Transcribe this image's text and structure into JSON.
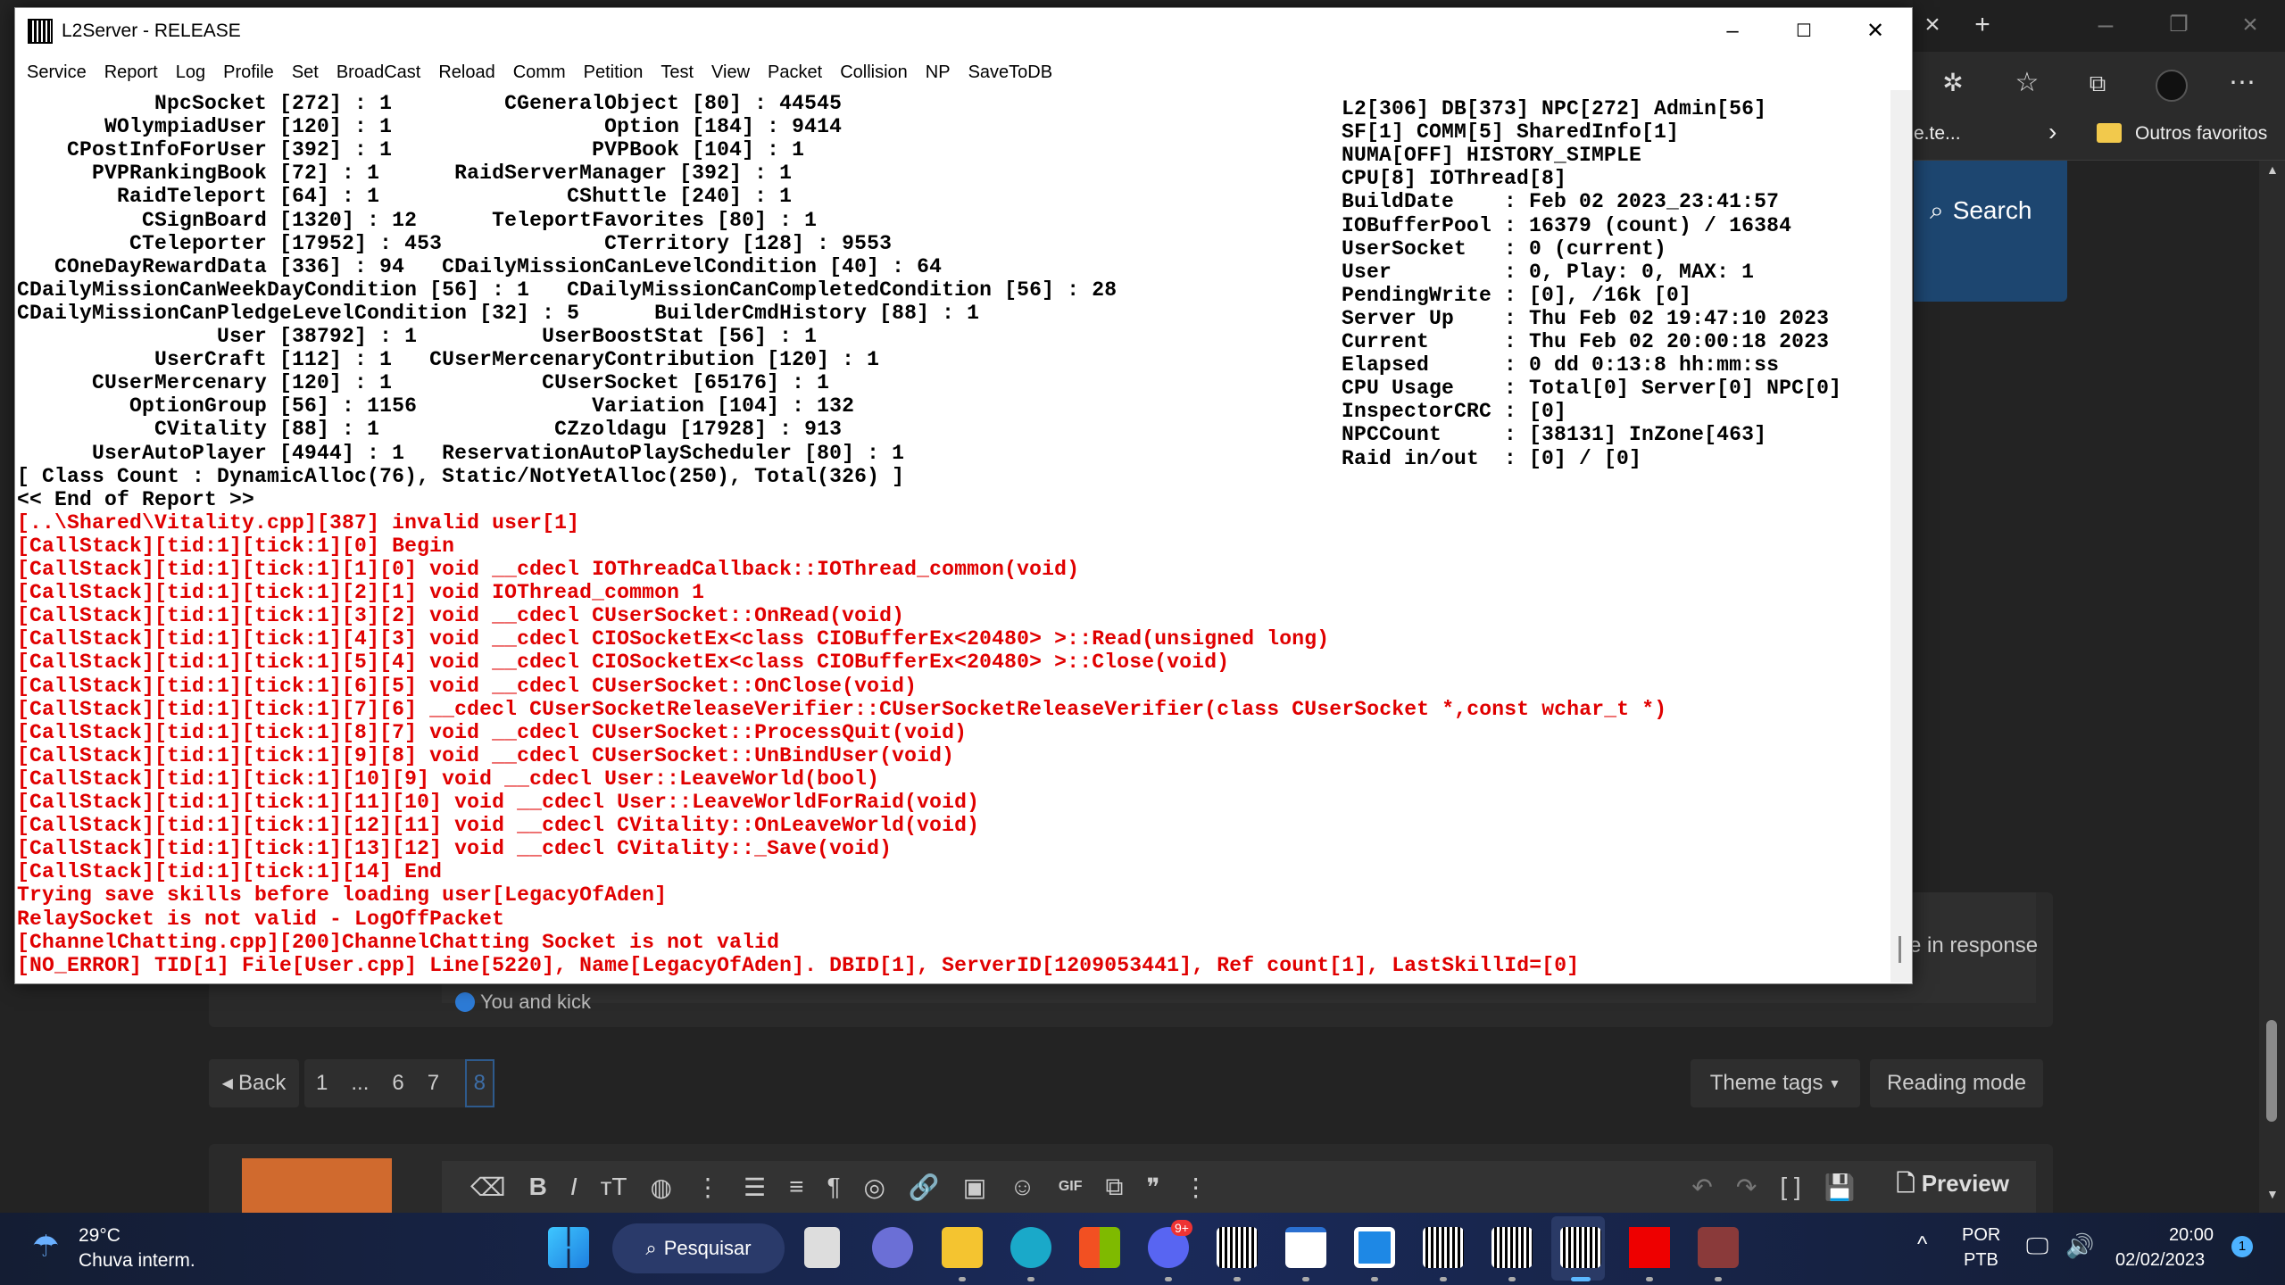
{
  "window": {
    "title": "L2Server - RELEASE"
  },
  "menu": [
    "Service",
    "Report",
    "Log",
    "Profile",
    "Set",
    "BroadCast",
    "Reload",
    "Comm",
    "Petition",
    "Test",
    "View",
    "Packet",
    "Collision",
    "NP",
    "SaveToDB"
  ],
  "report": {
    "rows": [
      [
        [
          "NpcSocket",
          "272",
          "1"
        ],
        [
          "CGeneralObject",
          "80",
          "44545"
        ]
      ],
      [
        [
          "WOlympiadUser",
          "120",
          "1"
        ],
        [
          "Option",
          "184",
          "9414"
        ]
      ],
      [
        [
          "CPostInfoForUser",
          "392",
          "1"
        ],
        [
          "PVPBook",
          "104",
          "1"
        ]
      ],
      [
        [
          "PVPRankingBook",
          "72",
          "1"
        ],
        [
          "RaidServerManager",
          "392",
          "1"
        ]
      ],
      [
        [
          "RaidTeleport",
          "64",
          "1"
        ],
        [
          "CShuttle",
          "240",
          "1"
        ]
      ],
      [
        [
          "CSignBoard",
          "1320",
          "12"
        ],
        [
          "TeleportFavorites",
          "80",
          "1"
        ]
      ],
      [
        [
          "CTeleporter",
          "17952",
          "453"
        ],
        [
          "CTerritory",
          "128",
          "9553"
        ]
      ],
      [
        [
          "COneDayRewardData",
          "336",
          "94"
        ],
        [
          "CDailyMissionCanLevelCondition",
          "40",
          "64"
        ]
      ],
      [
        [
          "CDailyMissionCanWeekDayCondition",
          "56",
          "1"
        ],
        [
          "CDailyMissionCanCompletedCondition",
          "56",
          "28"
        ]
      ],
      [
        [
          "CDailyMissionCanPledgeLevelCondition",
          "32",
          "5"
        ],
        [
          "BuilderCmdHistory",
          "88",
          "1"
        ]
      ],
      [
        [
          "User",
          "38792",
          "1"
        ],
        [
          "UserBoostStat",
          "56",
          "1"
        ]
      ],
      [
        [
          "UserCraft",
          "112",
          "1"
        ],
        [
          "CUserMercenaryContribution",
          "120",
          "1"
        ]
      ],
      [
        [
          "CUserMercenary",
          "120",
          "1"
        ],
        [
          "CUserSocket",
          "65176",
          "1"
        ]
      ],
      [
        [
          "OptionGroup",
          "56",
          "1156"
        ],
        [
          "Variation",
          "104",
          "132"
        ]
      ],
      [
        [
          "CVitality",
          "88",
          "1"
        ],
        [
          "CZzoldagu",
          "17928",
          "913"
        ]
      ],
      [
        [
          "UserAutoPlayer",
          "4944",
          "1"
        ],
        [
          "ReservationAutoPlayScheduler",
          "80",
          "1"
        ]
      ]
    ],
    "class_count": "[ Class Count : DynamicAlloc(76), Static/NotYetAlloc(250), Total(326) ]",
    "end": "<< End of Report >>"
  },
  "errors": [
    "[..\\Shared\\Vitality.cpp][387] invalid user[1]",
    "[CallStack][tid:1][tick:1][0] Begin",
    "[CallStack][tid:1][tick:1][1][0] void __cdecl IOThreadCallback::IOThread_common(void)",
    "[CallStack][tid:1][tick:1][2][1] void IOThread_common 1",
    "[CallStack][tid:1][tick:1][3][2] void __cdecl CUserSocket::OnRead(void)",
    "[CallStack][tid:1][tick:1][4][3] void __cdecl CIOSocketEx<class CIOBufferEx<20480> >::Read(unsigned long)",
    "[CallStack][tid:1][tick:1][5][4] void __cdecl CIOSocketEx<class CIOBufferEx<20480> >::Close(void)",
    "[CallStack][tid:1][tick:1][6][5] void __cdecl CUserSocket::OnClose(void)",
    "[CallStack][tid:1][tick:1][7][6] __cdecl CUserSocketReleaseVerifier::CUserSocketReleaseVerifier(class CUserSocket *,const wchar_t *)",
    "[CallStack][tid:1][tick:1][8][7] void __cdecl CUserSocket::ProcessQuit(void)",
    "[CallStack][tid:1][tick:1][9][8] void __cdecl CUserSocket::UnBindUser(void)",
    "[CallStack][tid:1][tick:1][10][9] void __cdecl User::LeaveWorld(bool)",
    "[CallStack][tid:1][tick:1][11][10] void __cdecl User::LeaveWorldForRaid(void)",
    "[CallStack][tid:1][tick:1][12][11] void __cdecl CVitality::OnLeaveWorld(void)",
    "[CallStack][tid:1][tick:1][13][12] void __cdecl CVitality::_Save(void)",
    "[CallStack][tid:1][tick:1][14] End",
    "Trying save skills before loading user[LegacyOfAden]",
    "RelaySocket is not valid - LogOffPacket",
    "[ChannelChatting.cpp][200]ChannelChatting Socket is not valid",
    "[NO_ERROR] TID[1] File[User.cpp] Line[5220], Name[LegacyOfAden]. DBID[1], ServerID[1209053441], Ref count[1], LastSkillId=[0]"
  ],
  "status": {
    "header": [
      "L2[306] DB[373] NPC[272] Admin[56]",
      "SF[1] COMM[5] SharedInfo[1]",
      "NUMA[OFF] HISTORY_SIMPLE",
      "CPU[8] IOThread[8]"
    ],
    "fields": [
      [
        "BuildDate",
        "Feb 02 2023_23:41:57"
      ],
      [
        "IOBufferPool",
        "16379 (count) / 16384"
      ],
      [
        "UserSocket",
        "0 (current)"
      ],
      [
        "User",
        "0, Play: 0, MAX: 1"
      ],
      [
        "PendingWrite",
        "[0], /16k [0]"
      ],
      [
        "Server Up",
        "Thu Feb 02 19:47:10 2023"
      ],
      [
        "Current",
        "Thu Feb 02 20:00:18 2023"
      ],
      [
        "Elapsed",
        "0 dd 0:13:8 hh:mm:ss"
      ],
      [
        "CPU Usage",
        "Total[0] Server[0] NPC[0]"
      ],
      [
        "InspectorCRC",
        "[0]"
      ],
      [
        "NPCCount",
        "[38131] InZone[463]"
      ],
      [
        "Raid in/out",
        "[0] / [0]"
      ]
    ]
  },
  "browser": {
    "bookmark_truncated": "e.te...",
    "other_favorites": "Outros favoritos",
    "search": "Search",
    "reply_hint": "e in response",
    "reactions": "You and kick",
    "pagination": {
      "back": "Back",
      "pages": [
        "1",
        "...",
        "6",
        "7",
        "8"
      ],
      "current": "8"
    },
    "theme_tags": "Theme tags",
    "reading_mode": "Reading mode",
    "preview": "Preview",
    "accent": "#1d4670"
  },
  "taskbar": {
    "weather_temp": "29°C",
    "weather_desc": "Chuva interm.",
    "search": "Pesquisar",
    "lang": "POR",
    "layout": "PTB",
    "time": "20:00",
    "date": "02/02/2023",
    "notifications": "1",
    "discord_badge": "9+"
  }
}
